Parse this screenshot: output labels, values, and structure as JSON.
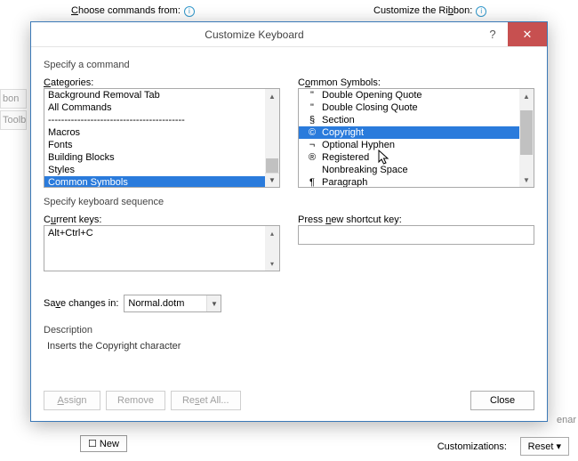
{
  "background": {
    "choose": "Choose commands from:",
    "ribbon": "Customize the Ribbon:",
    "left1": "bon",
    "left2": "Toolba",
    "new": "New",
    "cust": "Customizations:",
    "reset": "Reset",
    "enar": "enar"
  },
  "dialog": {
    "title": "Customize Keyboard",
    "specify_cmd": "Specify a command",
    "categories_label": "Categories:",
    "symbols_label": "Common Symbols:",
    "categories": [
      "Background Removal Tab",
      "All Commands",
      "------------------------------------------",
      "Macros",
      "Fonts",
      "Building Blocks",
      "Styles",
      "Common Symbols"
    ],
    "categories_selected": 7,
    "symbols": [
      {
        "glyph": "\"",
        "name": "Double Opening Quote"
      },
      {
        "glyph": "\"",
        "name": "Double Closing Quote"
      },
      {
        "glyph": "§",
        "name": "Section"
      },
      {
        "glyph": "©",
        "name": "Copyright"
      },
      {
        "glyph": "¬",
        "name": "Optional Hyphen"
      },
      {
        "glyph": "®",
        "name": "Registered"
      },
      {
        "glyph": " ",
        "name": "Nonbreaking Space"
      },
      {
        "glyph": "¶",
        "name": "Paragraph"
      }
    ],
    "symbols_selected": 3,
    "specify_seq": "Specify keyboard sequence",
    "current_keys_label": "Current keys:",
    "current_key": "Alt+Ctrl+C",
    "press_new_label": "Press new shortcut key:",
    "save_label": "Save changes in:",
    "save_value": "Normal.dotm",
    "desc_label": "Description",
    "desc_text": "Inserts the Copyright character",
    "buttons": {
      "assign": "Assign",
      "remove": "Remove",
      "reset": "Reset All...",
      "close": "Close"
    }
  }
}
